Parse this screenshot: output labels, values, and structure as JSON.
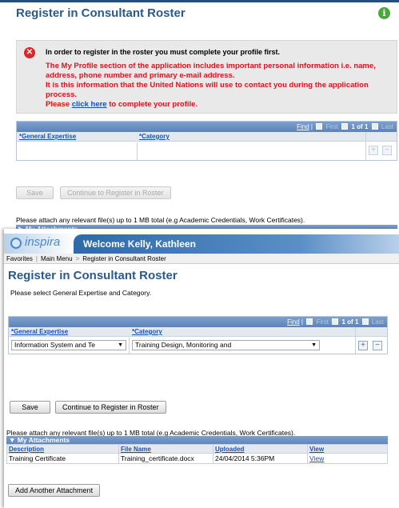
{
  "top": {
    "title": "Register in Consultant Roster",
    "message": {
      "heading": "In order to register in the roster you must complete your profile first.",
      "lines": [
        "The My Profile section of the application includes important personal information i.e. name,",
        "address, phone number and primary e-mail address.",
        "It is this information that the United Nations will use to contact you during the application",
        "process."
      ],
      "last_prefix": "Please ",
      "link_text": "click here",
      "last_suffix": " to complete your profile."
    },
    "grid": {
      "find": "Find",
      "first": "First",
      "page": "1 of 1",
      "last": "Last",
      "col_expertise": "*General Expertise",
      "col_category": "*Category"
    },
    "buttons": {
      "save": "Save",
      "continue": "Continue to Register in Roster"
    },
    "attach_note": "Please attach any relevant file(s) up to 1 MB total (e.g Academic Credentials, Work Certificates).",
    "attach_header": "My Attachments"
  },
  "bottom": {
    "logo_text": "inspira",
    "welcome": "Welcome Kelly, Kathleen",
    "nav": {
      "favorites": "Favorites",
      "main_menu": "Main Menu",
      "separator": ">",
      "crumb": "Register in Consultant Roster"
    },
    "title": "Register in Consultant Roster",
    "instruction": "Please select General Expertise and Category.",
    "grid": {
      "find": "Find",
      "first": "First",
      "page": "1 of 1",
      "last": "Last",
      "col_expertise": "*General Expertise",
      "col_category": "*Category",
      "expertise_value": "Information System and Te",
      "category_value": "Training Design, Monitoring and"
    },
    "buttons": {
      "save": "Save",
      "continue": "Continue to Register in Roster"
    },
    "attach_note": "Please attach any relevant file(s) up to 1 MB total (e.g Academic Credentials, Work Certificates).",
    "attach_header": "My Attachments",
    "table": {
      "headers": [
        "Description",
        "File Name",
        "Uploaded",
        "View"
      ],
      "row": [
        "Training Certificate",
        "Training_certificate.docx",
        "24/04/2014  5:36PM",
        "View"
      ]
    },
    "add_button": "Add Another Attachment"
  }
}
